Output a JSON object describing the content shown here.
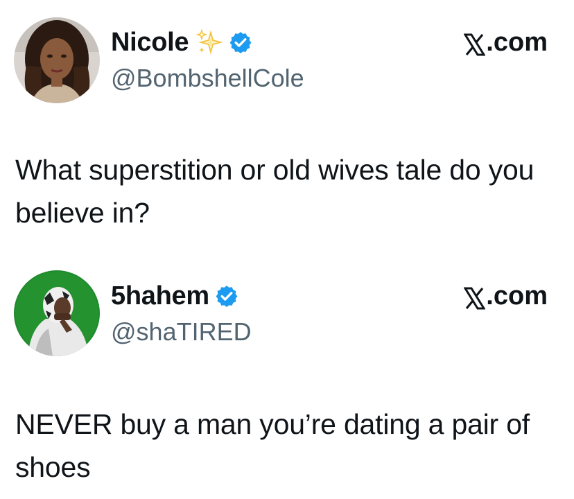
{
  "tweets": [
    {
      "display_name": "Nicole",
      "handle": "@BombshellCole",
      "source": ".com",
      "text": "What superstition or old wives tale do you believe in?",
      "icons": [
        "avatar",
        "sparkles-icon",
        "verified-icon",
        "x-logo-icon"
      ],
      "colors": {
        "verified": "#1d9bf0",
        "sparkles": "#f4c542"
      }
    },
    {
      "display_name": "5hahem",
      "handle": "@shaTIRED",
      "source": ".com",
      "text": "NEVER buy a man you’re dating a pair of shoes",
      "icons": [
        "avatar",
        "verified-icon",
        "x-logo-icon"
      ],
      "colors": {
        "verified": "#1d9bf0",
        "avatar_background": "#1f8a2e"
      }
    }
  ]
}
